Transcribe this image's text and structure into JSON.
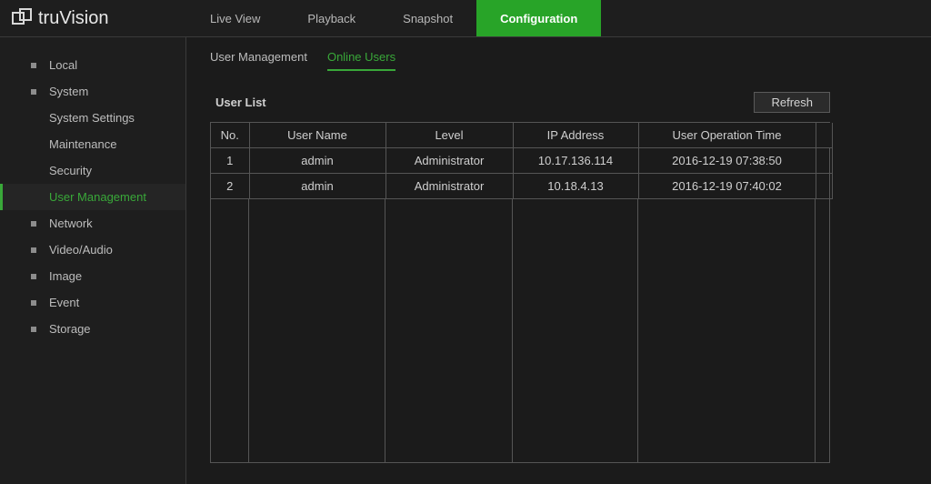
{
  "brand": {
    "name": "truVision"
  },
  "topnav": {
    "live": "Live View",
    "playback": "Playback",
    "snapshot": "Snapshot",
    "config": "Configuration"
  },
  "sidebar": {
    "local": "Local",
    "system": "System",
    "system_settings": "System Settings",
    "maintenance": "Maintenance",
    "security": "Security",
    "user_mgmt": "User Management",
    "network": "Network",
    "video_audio": "Video/Audio",
    "image": "Image",
    "event": "Event",
    "storage": "Storage"
  },
  "subtabs": {
    "user_mgmt": "User Management",
    "online_users": "Online Users"
  },
  "panel": {
    "title": "User List",
    "refresh": "Refresh",
    "headers": {
      "no": "No.",
      "username": "User Name",
      "level": "Level",
      "ip": "IP Address",
      "optime": "User Operation Time"
    },
    "rows": [
      {
        "no": "1",
        "username": "admin",
        "level": "Administrator",
        "ip": "10.17.136.114",
        "optime": "2016-12-19 07:38:50"
      },
      {
        "no": "2",
        "username": "admin",
        "level": "Administrator",
        "ip": "10.18.4.13",
        "optime": "2016-12-19 07:40:02"
      }
    ]
  }
}
